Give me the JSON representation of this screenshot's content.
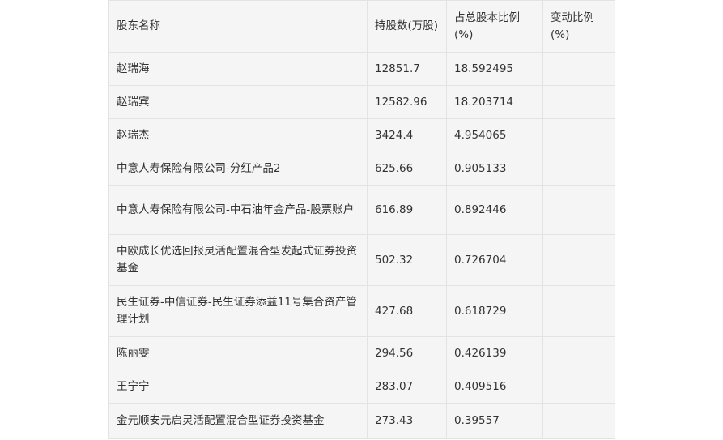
{
  "table": {
    "headers": [
      "股东名称",
      "持股数(万股)",
      "占总股本比例(%)",
      "变动比例(%)"
    ],
    "rows": [
      {
        "name": "赵瑞海",
        "shares": "12851.7",
        "ratio": "18.592495",
        "change": ""
      },
      {
        "name": "赵瑞宾",
        "shares": "12582.96",
        "ratio": "18.203714",
        "change": ""
      },
      {
        "name": "赵瑞杰",
        "shares": "3424.4",
        "ratio": "4.954065",
        "change": ""
      },
      {
        "name": "中意人寿保险有限公司-分红产品2",
        "shares": "625.66",
        "ratio": "0.905133",
        "change": ""
      },
      {
        "name": "中意人寿保险有限公司-中石油年金产品-股票账户",
        "shares": "616.89",
        "ratio": "0.892446",
        "change": ""
      },
      {
        "name": "中欧成长优选回报灵活配置混合型发起式证券投资基金",
        "shares": "502.32",
        "ratio": "0.726704",
        "change": ""
      },
      {
        "name": "民生证券-中信证券-民生证券添益11号集合资产管理计划",
        "shares": "427.68",
        "ratio": "0.618729",
        "change": ""
      },
      {
        "name": "陈丽雯",
        "shares": "294.56",
        "ratio": "0.426139",
        "change": ""
      },
      {
        "name": "王宁宁",
        "shares": "283.07",
        "ratio": "0.409516",
        "change": ""
      },
      {
        "name": "金元顺安元启灵活配置混合型证券投资基金",
        "shares": "273.43",
        "ratio": "0.39557",
        "change": ""
      }
    ]
  }
}
